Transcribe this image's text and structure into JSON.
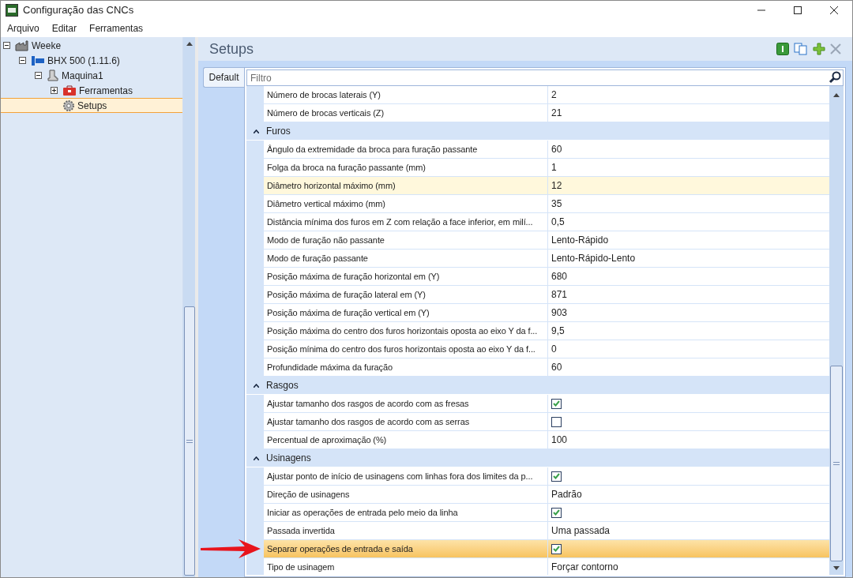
{
  "window": {
    "title": "Configuração das CNCs"
  },
  "menu": [
    "Arquivo",
    "Editar",
    "Ferramentas"
  ],
  "tree": [
    {
      "label": "Weeke",
      "expanded": true,
      "selected": false,
      "children": [
        {
          "label": "BHX 500 (1.11.6)",
          "expanded": true,
          "selected": false,
          "children": [
            {
              "label": "Maquina1",
              "expanded": true,
              "selected": false,
              "children": [
                {
                  "label": "Ferramentas",
                  "expanded": false,
                  "selected": false
                },
                {
                  "label": "Setups",
                  "selected": true
                }
              ]
            }
          ]
        }
      ]
    }
  ],
  "panel": {
    "title": "Setups",
    "tabs": [
      {
        "label": "Default",
        "selected": true
      }
    ],
    "filter": {
      "placeholder": "Filtro"
    }
  },
  "grid": [
    {
      "kind": "row",
      "label": "Número de brocas laterais (Y)",
      "value": "2",
      "selected": false,
      "hovered": false
    },
    {
      "kind": "row",
      "label": "Número de brocas verticais (Z)",
      "value": "21",
      "selected": false,
      "hovered": false
    },
    {
      "kind": "group",
      "label": "Furos",
      "expanded": true
    },
    {
      "kind": "row",
      "label": "Ângulo da extremidade da broca para furação passante",
      "value": "60",
      "selected": false,
      "hovered": false
    },
    {
      "kind": "row",
      "label": "Folga da broca na furação passante (mm)",
      "value": "1",
      "selected": false,
      "hovered": false
    },
    {
      "kind": "row",
      "label": "Diâmetro horizontal máximo (mm)",
      "value": "12",
      "selected": false,
      "hovered": true
    },
    {
      "kind": "row",
      "label": "Diâmetro vertical máximo (mm)",
      "value": "35",
      "selected": false,
      "hovered": false
    },
    {
      "kind": "row",
      "label": "Distância mínima dos furos em Z com relação a face inferior, em milí...",
      "value": "0,5",
      "selected": false,
      "hovered": false
    },
    {
      "kind": "row",
      "label": "Modo de furação não passante",
      "value": "Lento-Rápido",
      "selected": false,
      "hovered": false
    },
    {
      "kind": "row",
      "label": "Modo de furação passante",
      "value": "Lento-Rápido-Lento",
      "selected": false,
      "hovered": false
    },
    {
      "kind": "row",
      "label": "Posição máxima de furação horizontal em (Y)",
      "value": "680",
      "selected": false,
      "hovered": false
    },
    {
      "kind": "row",
      "label": "Posição máxima de furação lateral em (Y)",
      "value": "871",
      "selected": false,
      "hovered": false
    },
    {
      "kind": "row",
      "label": "Posição máxima de furação vertical em (Y)",
      "value": "903",
      "selected": false,
      "hovered": false
    },
    {
      "kind": "row",
      "label": "Posição máxima do centro dos furos horizontais oposta ao eixo Y da f...",
      "value": "9,5",
      "selected": false,
      "hovered": false
    },
    {
      "kind": "row",
      "label": "Posição mínima do centro dos furos horizontais oposta ao eixo Y da f...",
      "value": "0",
      "selected": false,
      "hovered": false
    },
    {
      "kind": "row",
      "label": "Profundidade máxima da furação",
      "value": "60",
      "selected": false,
      "hovered": false
    },
    {
      "kind": "group",
      "label": "Rasgos",
      "expanded": true
    },
    {
      "kind": "check",
      "label": "Ajustar tamanho dos rasgos de acordo com as fresas",
      "checked": true,
      "selected": false,
      "hovered": false
    },
    {
      "kind": "check",
      "label": "Ajustar tamanho dos rasgos de acordo com as serras",
      "checked": false,
      "selected": false,
      "hovered": false
    },
    {
      "kind": "row",
      "label": "Percentual de aproximação (%)",
      "value": "100",
      "selected": false,
      "hovered": false
    },
    {
      "kind": "group",
      "label": "Usinagens",
      "expanded": true
    },
    {
      "kind": "check",
      "label": "Ajustar ponto de início de usinagens com linhas fora dos limites da p...",
      "checked": true,
      "selected": false,
      "hovered": false
    },
    {
      "kind": "row",
      "label": "Direção de usinagens",
      "value": "Padrão",
      "selected": false,
      "hovered": false
    },
    {
      "kind": "check",
      "label": "Iniciar as operações de entrada pelo meio da linha",
      "checked": true,
      "selected": false,
      "hovered": false
    },
    {
      "kind": "row",
      "label": "Passada invertida",
      "value": "Uma passada",
      "selected": false,
      "hovered": false
    },
    {
      "kind": "check",
      "label": "Separar operações de entrada e saída",
      "checked": true,
      "selected": true,
      "hovered": false
    },
    {
      "kind": "row",
      "label": "Tipo de usinagem",
      "value": "Forçar contorno",
      "selected": false,
      "hovered": false
    }
  ]
}
